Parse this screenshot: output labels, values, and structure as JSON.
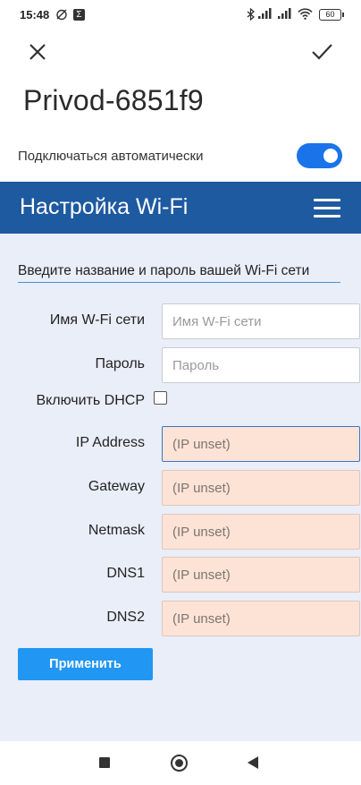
{
  "status_bar": {
    "time": "15:48",
    "battery": "60",
    "icons": [
      "no-alarm-icon",
      "sigma-app-icon",
      "bluetooth-icon",
      "signal-icon",
      "signal-icon-2",
      "wifi-icon",
      "battery-icon"
    ]
  },
  "dialog": {
    "network_name": "Privod-6851f9",
    "auto_connect_label": "Подключаться автоматически",
    "auto_connect_enabled": true,
    "accent_color": "#1a73e8"
  },
  "web": {
    "header_title": "Настройка Wi-Fi",
    "header_color": "#1e5aa0",
    "instruction": "Введите название и пароль вашей Wi-Fi сети",
    "fields": {
      "ssid": {
        "label": "Имя W-Fi сети",
        "placeholder": "Имя W-Fi сети",
        "value": ""
      },
      "password": {
        "label": "Пароль",
        "placeholder": "Пароль",
        "value": ""
      },
      "dhcp": {
        "label": "Включить DHCP",
        "checked": false
      },
      "ip_address": {
        "label": "IP Address",
        "placeholder": "(IP unset)"
      },
      "gateway": {
        "label": "Gateway",
        "placeholder": "(IP unset)"
      },
      "netmask": {
        "label": "Netmask",
        "placeholder": "(IP unset)"
      },
      "dns1": {
        "label": "DNS1",
        "placeholder": "(IP unset)"
      },
      "dns2": {
        "label": "DNS2",
        "placeholder": "(IP unset)"
      }
    },
    "apply_label": "Применить",
    "apply_color": "#2196f3",
    "ip_field_color": "#fde2d6"
  }
}
